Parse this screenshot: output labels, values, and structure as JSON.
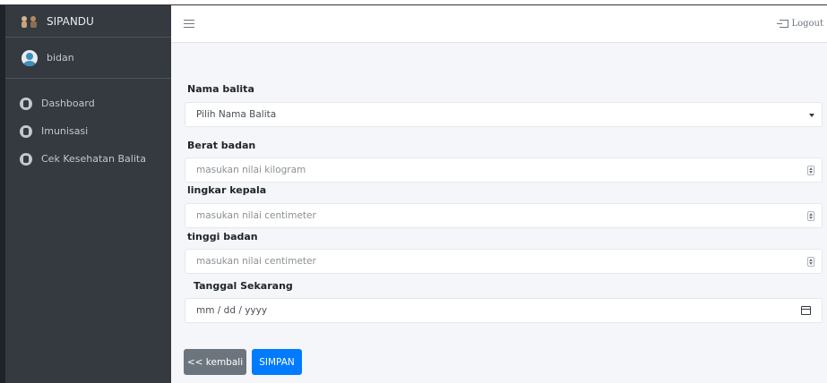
{
  "app": {
    "brand": "SIPANDU",
    "user": "bidan",
    "logout_label": "Logout"
  },
  "sidebar": {
    "items": [
      {
        "label": "Dashboard"
      },
      {
        "label": "Imunisasi"
      },
      {
        "label": "Cek Kesehatan Balita"
      }
    ]
  },
  "form": {
    "nama_balita": {
      "label": "Nama balita",
      "selected": "Pilih Nama Balita"
    },
    "berat_badan": {
      "label": "Berat badan",
      "placeholder": "masukan nilai kilogram"
    },
    "lingkar_kepala": {
      "label": "lingkar kepala",
      "placeholder": "masukan nilai centimeter"
    },
    "tinggi_badan": {
      "label": "tinggi badan",
      "placeholder": "masukan nilai centimeter"
    },
    "tanggal": {
      "label": "Tanggal Sekarang",
      "value": "mm / dd / yyyy"
    }
  },
  "buttons": {
    "back": "<< kembali",
    "save": "SIMPAN"
  },
  "colors": {
    "sidebar": "#343a40",
    "primary": "#007bff",
    "secondary": "#6c757d"
  }
}
